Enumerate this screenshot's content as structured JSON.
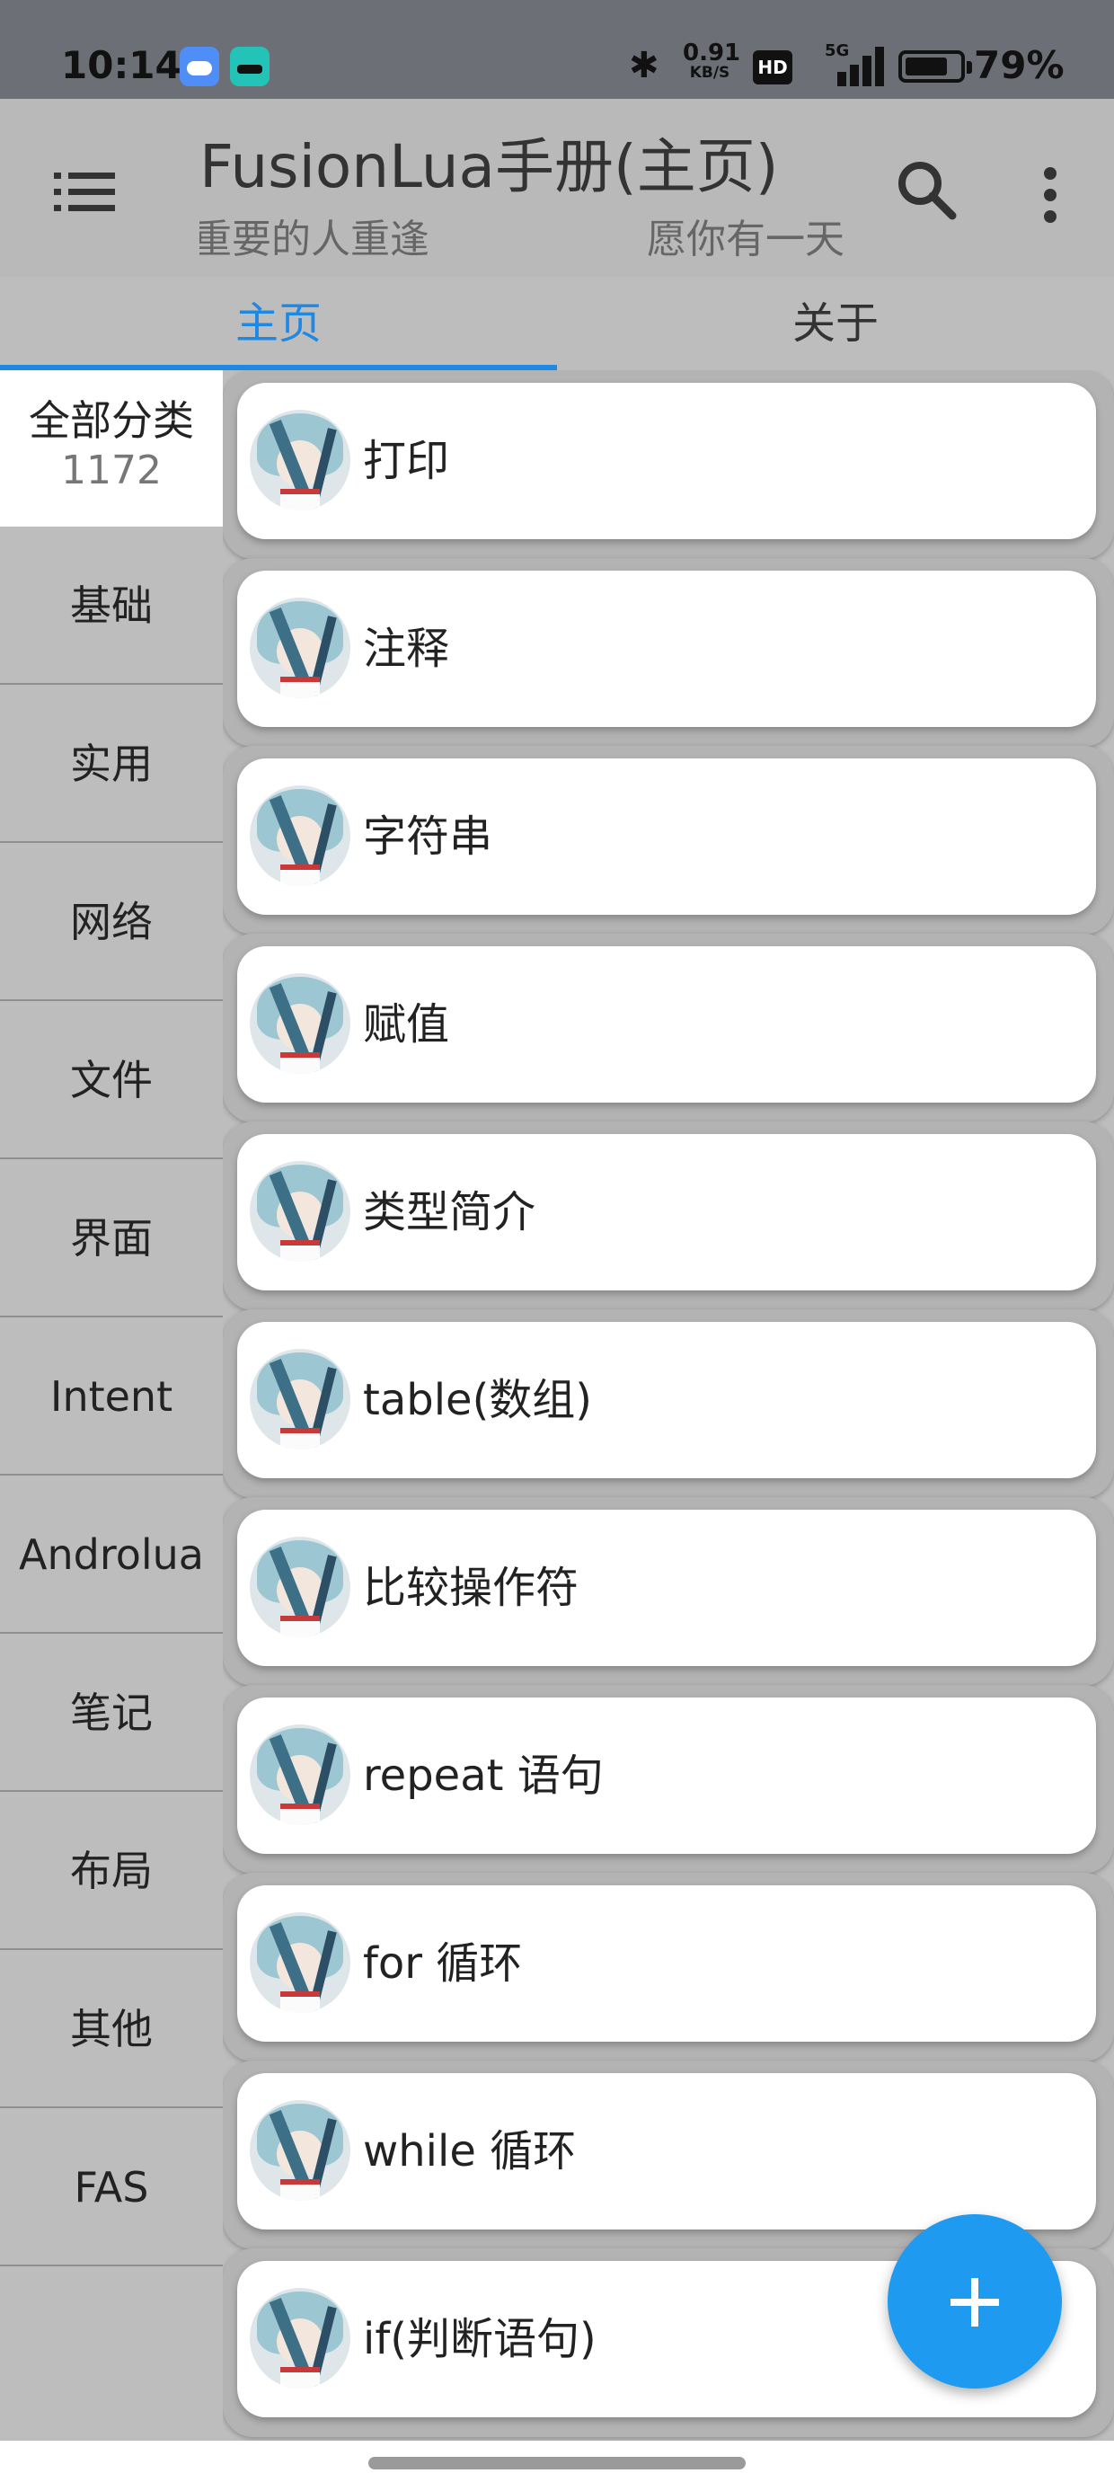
{
  "status_bar": {
    "time": "10:14",
    "speed_value": "0.91",
    "speed_unit": "KB/S",
    "hd": "HD",
    "network": "5G",
    "battery_level": 0.79,
    "battery_percent": "79%"
  },
  "app_bar": {
    "title": "FusionLua手册(主页)",
    "marquee_left": "重要的人重逢",
    "marquee_right": "愿你有一天"
  },
  "tabs": [
    {
      "label": "主页",
      "active": true
    },
    {
      "label": "关于",
      "active": false
    }
  ],
  "sidebar": {
    "items": [
      {
        "label": "全部分类",
        "count": "1172",
        "active": true
      },
      {
        "label": "基础"
      },
      {
        "label": "实用"
      },
      {
        "label": "网络"
      },
      {
        "label": "文件"
      },
      {
        "label": "界面"
      },
      {
        "label": "Intent"
      },
      {
        "label": "Androlua"
      },
      {
        "label": "笔记"
      },
      {
        "label": "布局"
      },
      {
        "label": "其他"
      },
      {
        "label": "FAS"
      }
    ]
  },
  "list": {
    "items": [
      {
        "label": "打印"
      },
      {
        "label": "注释"
      },
      {
        "label": "字符串"
      },
      {
        "label": "赋值"
      },
      {
        "label": "类型简介"
      },
      {
        "label": "table(数组)"
      },
      {
        "label": "比较操作符"
      },
      {
        "label": "repeat 语句"
      },
      {
        "label": "for 循环"
      },
      {
        "label": "while 循环"
      },
      {
        "label": "if(判断语句)"
      }
    ]
  },
  "fab": {
    "icon": "plus-icon"
  },
  "colors": {
    "accent": "#1e88e5",
    "fab": "#1e9bf0",
    "status_bar": "#6c6f76",
    "app_bar": "#b9b9b9",
    "background": "#bdbdbd",
    "card": "#ffffff"
  }
}
